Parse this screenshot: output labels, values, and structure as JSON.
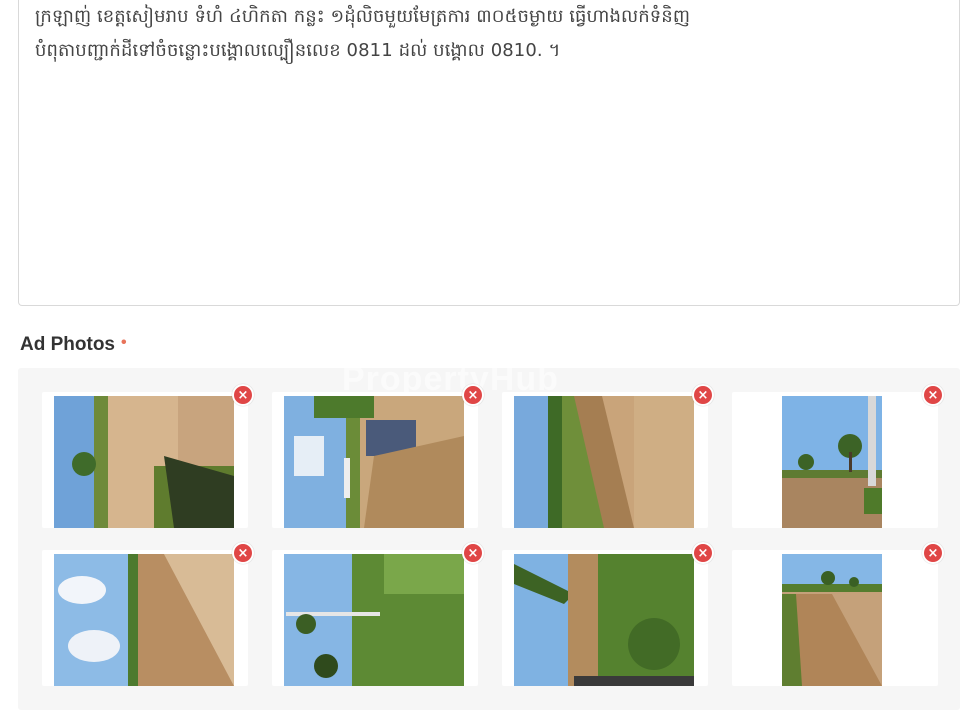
{
  "description": {
    "line1": "ក្រឡាញ់ ខេត្តសៀមរាប ទំហំ ៤ហិកតា កន្លះ ១ដុំលិចមួយមែត្រការ ៣០៥ចម្ងាយ ធ្វើហាងលក់ទំនិញ",
    "line2": "បំពុតាបញ្ជាក់ដីទៅចំចន្លោះបង្គោលល្បឿនលេខ 0811 ដល់ បង្គោល 0810. ។"
  },
  "photos_section": {
    "label": "Ad Photos",
    "required_mark": "•",
    "watermark": "PropertyHub"
  },
  "photos": [
    {
      "icon": "landscape-photo-icon",
      "remove_icon": "remove-x-icon",
      "remove_glyph": "×"
    },
    {
      "icon": "landscape-photo-icon",
      "remove_icon": "remove-x-icon",
      "remove_glyph": "×"
    },
    {
      "icon": "landscape-photo-icon",
      "remove_icon": "remove-x-icon",
      "remove_glyph": "×"
    },
    {
      "icon": "landscape-photo-icon",
      "remove_icon": "remove-x-icon",
      "remove_glyph": "×"
    },
    {
      "icon": "landscape-photo-icon",
      "remove_icon": "remove-x-icon",
      "remove_glyph": "×"
    },
    {
      "icon": "landscape-photo-icon",
      "remove_icon": "remove-x-icon",
      "remove_glyph": "×"
    },
    {
      "icon": "landscape-photo-icon",
      "remove_icon": "remove-x-icon",
      "remove_glyph": "×"
    },
    {
      "icon": "landscape-photo-icon",
      "remove_icon": "remove-x-icon",
      "remove_glyph": "×"
    }
  ],
  "colors": {
    "remove_button": "#e04646",
    "required_mark": "#e8735a",
    "panel_bg": "#f6f6f6"
  }
}
